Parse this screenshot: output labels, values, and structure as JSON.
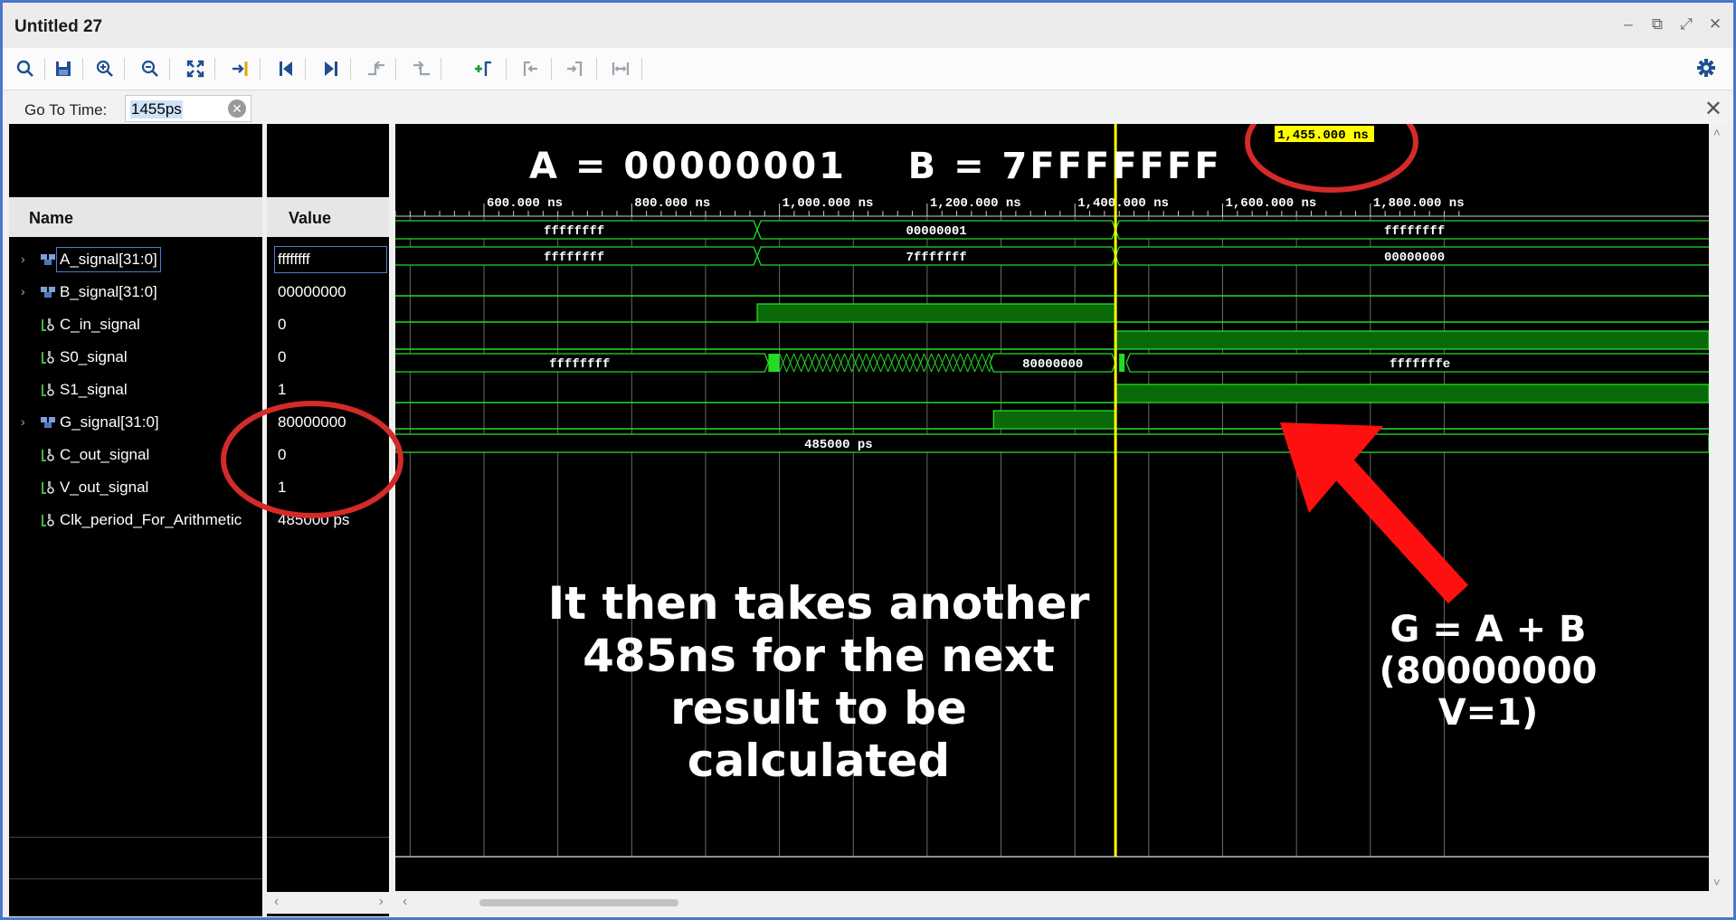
{
  "window": {
    "title": "Untitled 27"
  },
  "toolbar": {
    "icons": [
      "search-icon",
      "save-icon",
      "zoom-in-icon",
      "zoom-out-icon",
      "zoom-fit-icon",
      "go-to-cursor-icon",
      "go-to-start-icon",
      "go-to-end-icon",
      "previous-transition-icon",
      "next-transition-icon",
      "add-marker-icon",
      "previous-marker-icon",
      "next-marker-icon",
      "swap-cursors-icon",
      "settings-gear-icon"
    ]
  },
  "goto": {
    "label": "Go To Time:",
    "value": "1455ps"
  },
  "columns": {
    "name": "Name",
    "value": "Value"
  },
  "signals": [
    {
      "name": "A_signal[31:0]",
      "value": "ffffffff",
      "type": "bus"
    },
    {
      "name": "B_signal[31:0]",
      "value": "00000000",
      "type": "bus"
    },
    {
      "name": "C_in_signal",
      "value": "0",
      "type": "bit"
    },
    {
      "name": "S0_signal",
      "value": "0",
      "type": "bit"
    },
    {
      "name": "S1_signal",
      "value": "1",
      "type": "bit"
    },
    {
      "name": "G_signal[31:0]",
      "value": "80000000",
      "type": "bus"
    },
    {
      "name": "C_out_signal",
      "value": "0",
      "type": "bit"
    },
    {
      "name": "V_out_signal",
      "value": "1",
      "type": "bit"
    },
    {
      "name": "Clk_period_For_Arithmetic",
      "value": "485000 ps",
      "type": "bit"
    }
  ],
  "cursor": {
    "label": "1,455.000 ns",
    "time_ns": 1455
  },
  "timeline": {
    "ticks": [
      "600.000 ns",
      "800.000 ns",
      "1,000.000 ns",
      "1,200.000 ns",
      "1,400.000 ns",
      "1,600.000 ns",
      "1,800.000 ns"
    ]
  },
  "waves": {
    "a": [
      "ffffffff",
      "00000001",
      "ffffffff"
    ],
    "b": [
      "ffffffff",
      "7fffffff",
      "00000000"
    ],
    "g": [
      "ffffffff",
      "80000000",
      "fffffffe"
    ],
    "clk": "485000 ps"
  },
  "annotations": {
    "top": "A = 00000001    B = 7FFFFFFF",
    "middle": [
      "It then takes another",
      "485ns for the next",
      "result to be",
      "calculated"
    ],
    "right": [
      "G = A + B",
      "(80000000",
      "V=1)"
    ]
  },
  "colors": {
    "wave": "#22dd22",
    "cursor": "#ffff00",
    "circle": "#d42a2a",
    "arrow": "#ff1010"
  }
}
